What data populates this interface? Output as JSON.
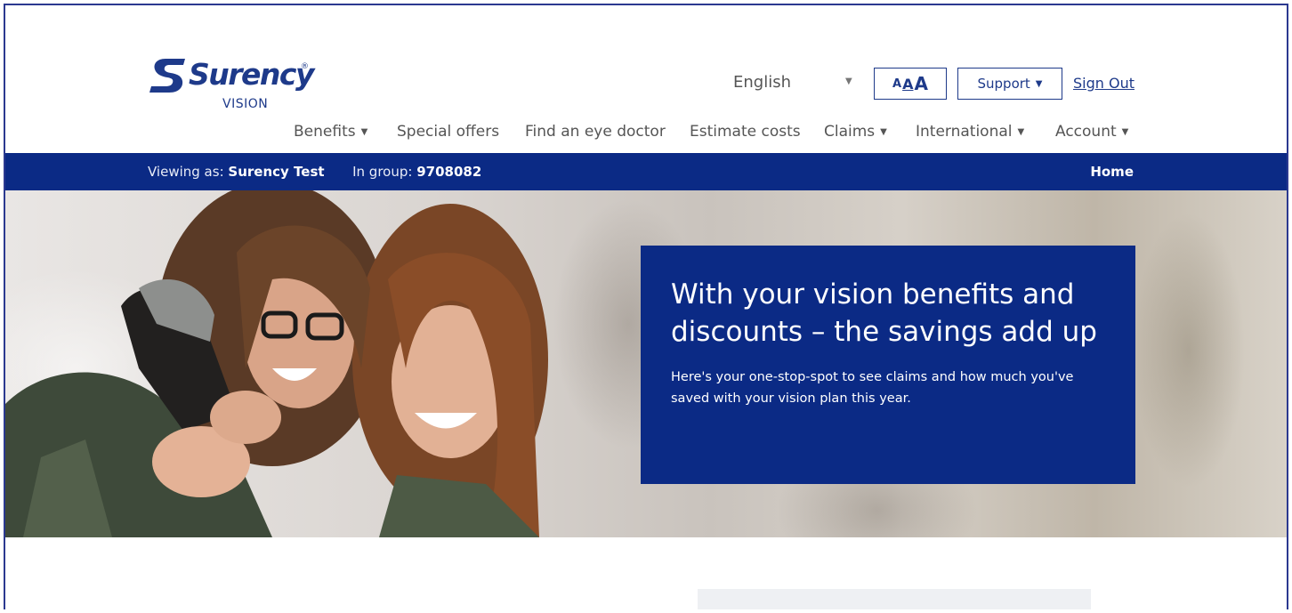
{
  "brand": {
    "name": "Surency",
    "tm": "®",
    "sub": "VISION",
    "color": "#1e3a8a"
  },
  "utils": {
    "language": "English",
    "text_size": [
      "A",
      "A",
      "A"
    ],
    "support_label": "Support",
    "signout_label": "Sign Out"
  },
  "nav": [
    {
      "label": "Benefits",
      "dropdown": true
    },
    {
      "label": "Special offers",
      "dropdown": false
    },
    {
      "label": "Find an eye doctor",
      "dropdown": false
    },
    {
      "label": "Estimate costs",
      "dropdown": false
    },
    {
      "label": "Claims",
      "dropdown": true
    },
    {
      "label": "International",
      "dropdown": true
    },
    {
      "label": "Account",
      "dropdown": true
    }
  ],
  "bar": {
    "viewing_label": "Viewing as:",
    "viewing_value": "Surency Test",
    "group_label": "In group:",
    "group_value": "9708082",
    "home": "Home",
    "color": "#0b2a85"
  },
  "hero": {
    "title": "With your vision benefits and discounts – the savings add up",
    "text": "Here's your one-stop-spot to see claims and how much you've saved with your vision plan this year."
  },
  "icons": {
    "logo": "surency-s-logo-icon",
    "caret": "caret-down-icon"
  }
}
